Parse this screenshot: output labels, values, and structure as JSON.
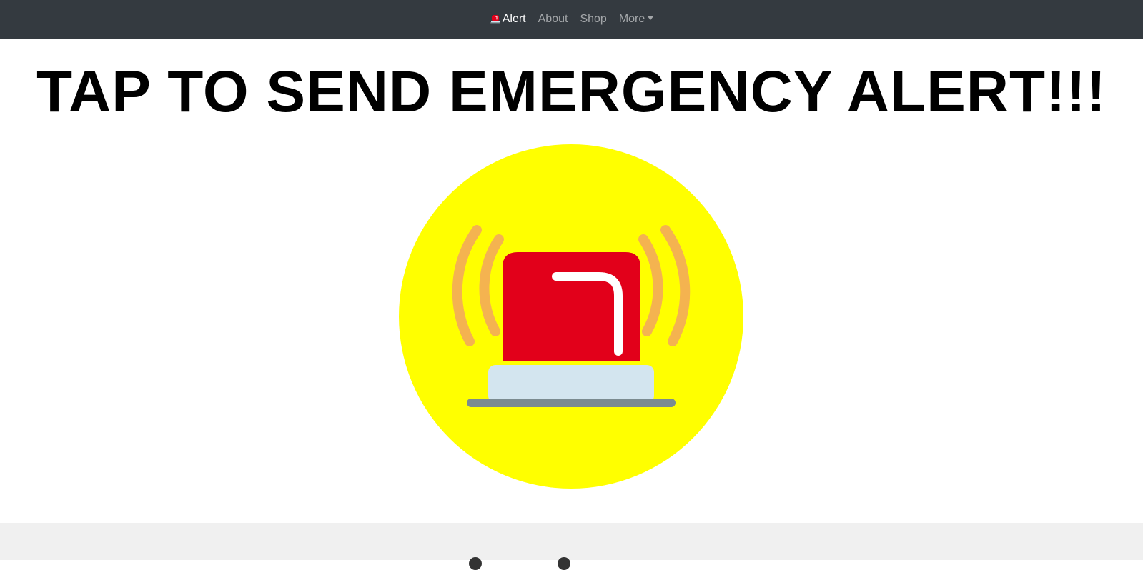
{
  "navbar": {
    "brand_icon": "siren-icon",
    "brand_label": "Alert",
    "links": [
      {
        "label": "About"
      },
      {
        "label": "Shop"
      },
      {
        "label": "More"
      }
    ]
  },
  "main": {
    "headline": "TAP TO SEND EMERGENCY ALERT!!!",
    "alert_icon": "siren-icon"
  },
  "colors": {
    "navbar_bg": "#343a40",
    "circle_bg": "#ffff00",
    "siren_red": "#e2001a",
    "siren_base": "#d3e5ef",
    "siren_plate": "#7b8b90",
    "waves": "#f4b350",
    "footer_bg": "#f0f0f0"
  }
}
